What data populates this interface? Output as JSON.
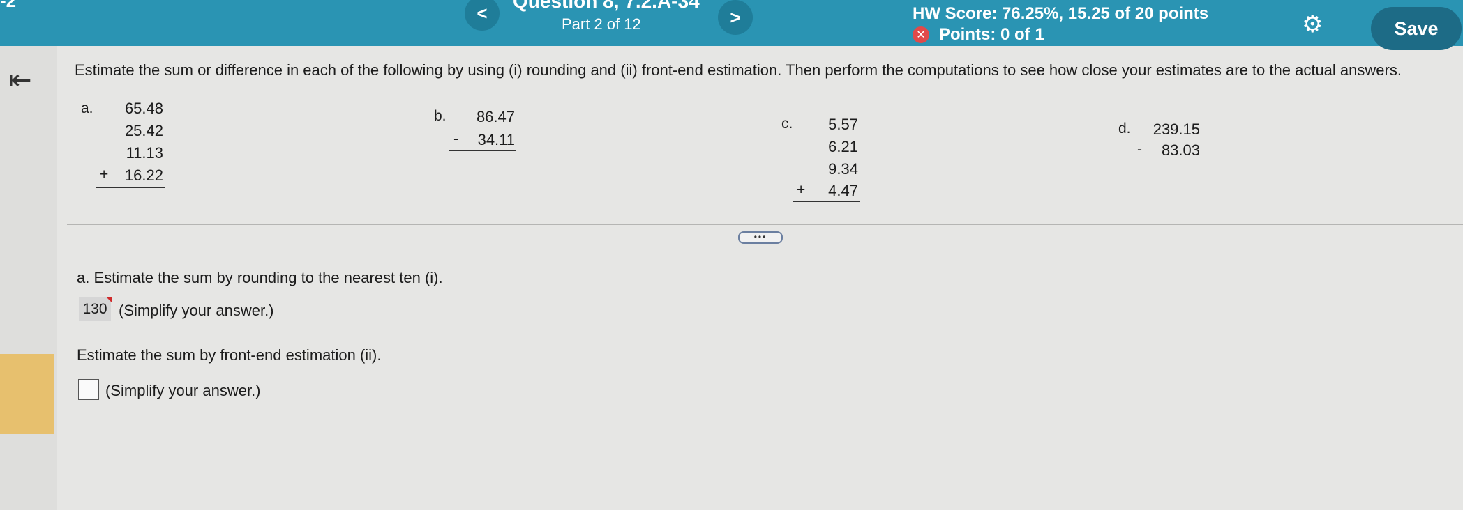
{
  "header": {
    "corner_text": "-2",
    "question_title": "Question 8, 7.2.A-34",
    "part_label": "Part 2 of 12",
    "prev_label": "<",
    "next_label": ">",
    "hw_score": "HW Score: 76.25%, 15.25 of 20 points",
    "points": "Points: 0 of 1",
    "save_label": "Save"
  },
  "instructions": "Estimate the sum or difference in each of the following by using (i) rounding and (ii) front-end estimation. Then perform the computations to see how close your estimates are to the actual answers.",
  "problems": {
    "a": {
      "label": "a.",
      "n1": "65.48",
      "n2": "25.42",
      "n3": "11.13",
      "n4": "16.22",
      "op": "+"
    },
    "b": {
      "label": "b.",
      "n1": "86.47",
      "n2": "34.11",
      "op": "-"
    },
    "c": {
      "label": "c.",
      "n1": "5.57",
      "n2": "6.21",
      "n3": "9.34",
      "n4": "4.47",
      "op": "+"
    },
    "d": {
      "label": "d.",
      "n1": "239.15",
      "n2": "83.03",
      "op": "-"
    }
  },
  "more_label": "•••",
  "part_a": {
    "prompt": "a. Estimate the sum by rounding to the nearest ten (i).",
    "answer": "130",
    "simplify": "(Simplify your answer.)"
  },
  "part_b": {
    "prompt": "Estimate the sum by front-end estimation (ii).",
    "simplify": "(Simplify your answer.)"
  },
  "colors": {
    "header_bg": "#2a94b3",
    "save_bg": "#1d6b86",
    "error_red": "#e04a4a",
    "side_tab": "#e7c06e"
  }
}
